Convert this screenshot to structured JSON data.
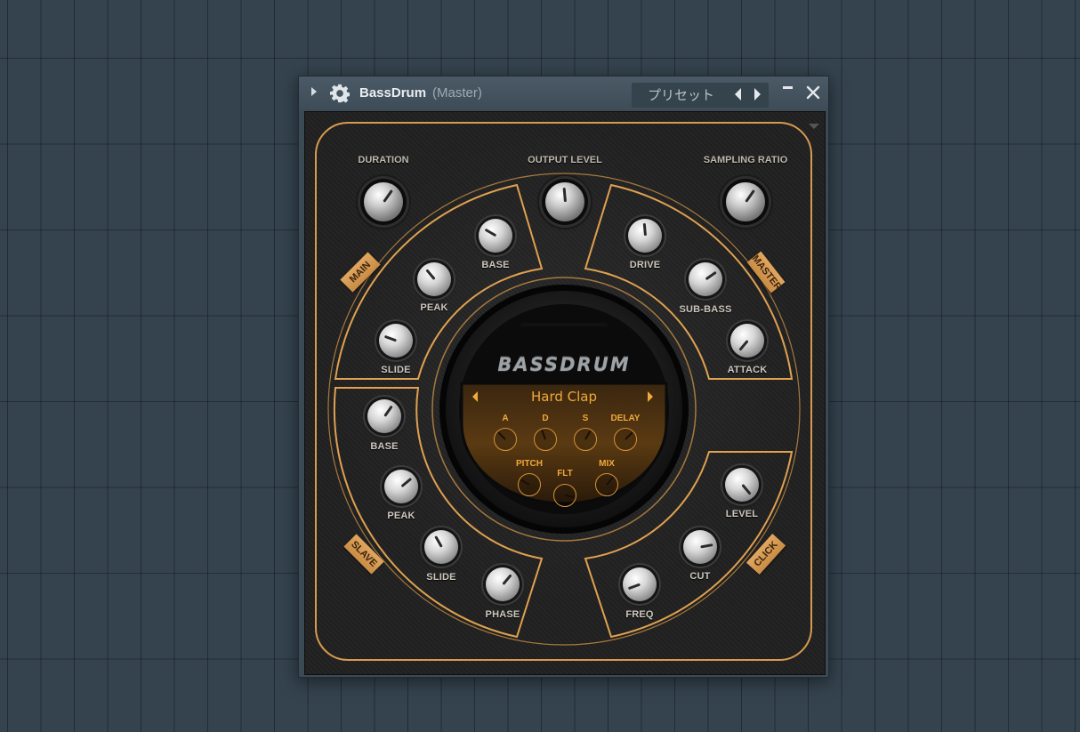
{
  "window": {
    "title": "BassDrum",
    "subtitle": "(Master)",
    "preset_label": "プリセット"
  },
  "plugin": {
    "logo": "BASSDRUM",
    "headers": {
      "duration": "DURATION",
      "output_level": "OUTPUT LEVEL",
      "sampling_ratio": "SAMPLING RATIO"
    },
    "tags": {
      "main": "MAIN",
      "master": "MASTER",
      "slave": "SLAVE",
      "click": "CLICK"
    },
    "main": {
      "base": "BASE",
      "peak": "PEAK",
      "slide": "SLIDE"
    },
    "master": {
      "drive": "DRIVE",
      "sub_bass": "SUB-BASS",
      "attack": "ATTACK"
    },
    "slave": {
      "base": "BASE",
      "peak": "PEAK",
      "slide": "SLIDE",
      "phase": "PHASE"
    },
    "click": {
      "level": "LEVEL",
      "cut": "CUT",
      "freq": "FREQ"
    },
    "screen": {
      "sample_name": "Hard Clap",
      "a": "A",
      "d": "D",
      "s": "S",
      "delay": "DELAY",
      "pitch": "PITCH",
      "flt": "FLT",
      "mix": "MIX"
    }
  },
  "colors": {
    "accent_orange": "#e0a150",
    "screen_text": "#f0a93a",
    "background": "#34434e"
  },
  "icons": [
    "expand-arrow-icon",
    "gear-icon",
    "prev-preset-icon",
    "next-preset-icon",
    "minimize-icon",
    "close-icon",
    "prev-sample-icon",
    "next-sample-icon"
  ]
}
